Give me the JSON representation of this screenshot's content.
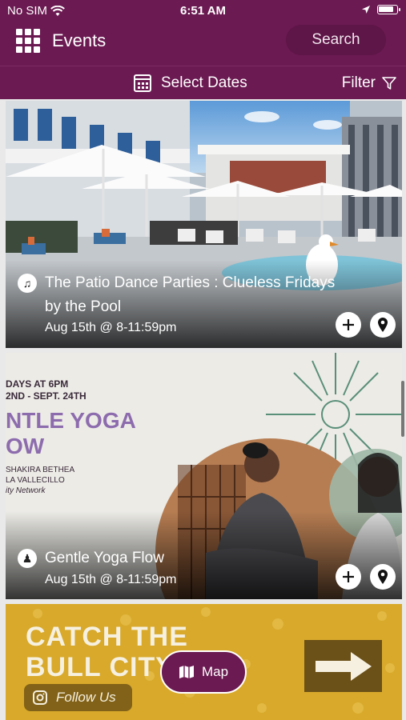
{
  "status_bar": {
    "carrier": "No SIM",
    "time": "6:51 AM"
  },
  "header": {
    "title": "Events",
    "search_label": "Search",
    "select_dates_label": "Select Dates",
    "filter_label": "Filter"
  },
  "colors": {
    "brand": "#6b1a52",
    "brand_dark": "#5e1547",
    "poster_gold": "#d8a92a"
  },
  "events": [
    {
      "title": "The Patio Dance Parties : Clueless Fridays by the Pool",
      "date": "Aug 15th @ 8-11:59pm",
      "category_icon": "guitar-icon"
    },
    {
      "title": "Gentle Yoga Flow",
      "date": "Aug 15th @ 8-11:59pm",
      "category_icon": "people-icon",
      "poster": {
        "line1": "DAYS AT 6PM",
        "line2": "2ND - SEPT. 24TH",
        "headline1": "NTLE YOGA",
        "headline2": "OW",
        "names1": "SHAKIRA BETHEA",
        "names2": "LA VALLECILLO",
        "network": "ity Network"
      }
    },
    {
      "poster": {
        "headline1": "CATCH THE",
        "headline2": "BULL CITY",
        "follow_label": "Follow Us"
      }
    }
  ],
  "map_button": {
    "label": "Map"
  }
}
